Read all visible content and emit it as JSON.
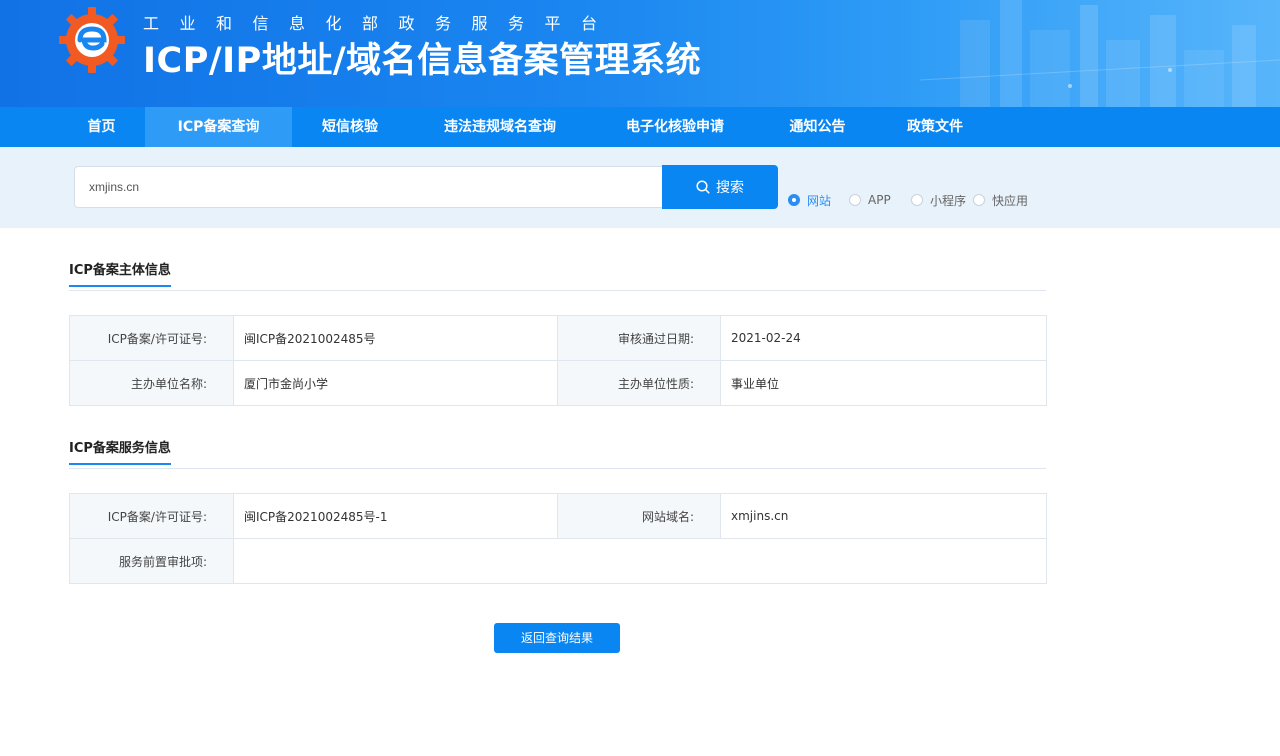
{
  "header": {
    "sup_title": "工业和信息化部政务服务平台",
    "main_title": "ICP/IP地址/域名信息备案管理系统",
    "logo_icon": "gear-e-logo"
  },
  "nav": {
    "items": [
      {
        "label": "首页",
        "active": false
      },
      {
        "label": "ICP备案查询",
        "active": true
      },
      {
        "label": "短信核验",
        "active": false
      },
      {
        "label": "违法违规域名查询",
        "active": false
      },
      {
        "label": "电子化核验申请",
        "active": false
      },
      {
        "label": "通知公告",
        "active": false
      },
      {
        "label": "政策文件",
        "active": false
      }
    ]
  },
  "search": {
    "value": "xmjins.cn",
    "button_label": "搜索",
    "button_icon": "search-icon",
    "options": [
      {
        "label": "网站",
        "checked": true
      },
      {
        "label": "APP",
        "checked": false
      },
      {
        "label": "小程序",
        "checked": false
      },
      {
        "label": "快应用",
        "checked": false
      }
    ]
  },
  "subject_info": {
    "title": "ICP备案主体信息",
    "rows": [
      {
        "label1": "ICP备案/许可证号:",
        "value1": "闽ICP备2021002485号",
        "label2": "审核通过日期:",
        "value2": "2021-02-24"
      },
      {
        "label1": "主办单位名称:",
        "value1": "厦门市金尚小学",
        "label2": "主办单位性质:",
        "value2": "事业单位"
      }
    ]
  },
  "service_info": {
    "title": "ICP备案服务信息",
    "row1": {
      "label1": "ICP备案/许可证号:",
      "value1": "闽ICP备2021002485号-1",
      "label2": "网站域名:",
      "value2": "xmjins.cn"
    },
    "row2": {
      "label": "服务前置审批项:",
      "value": ""
    }
  },
  "back_button": "返回查询结果",
  "colors": {
    "primary": "#0a86f3",
    "nav_active": "#2e9cf7",
    "search_band": "#e8f2fb"
  }
}
